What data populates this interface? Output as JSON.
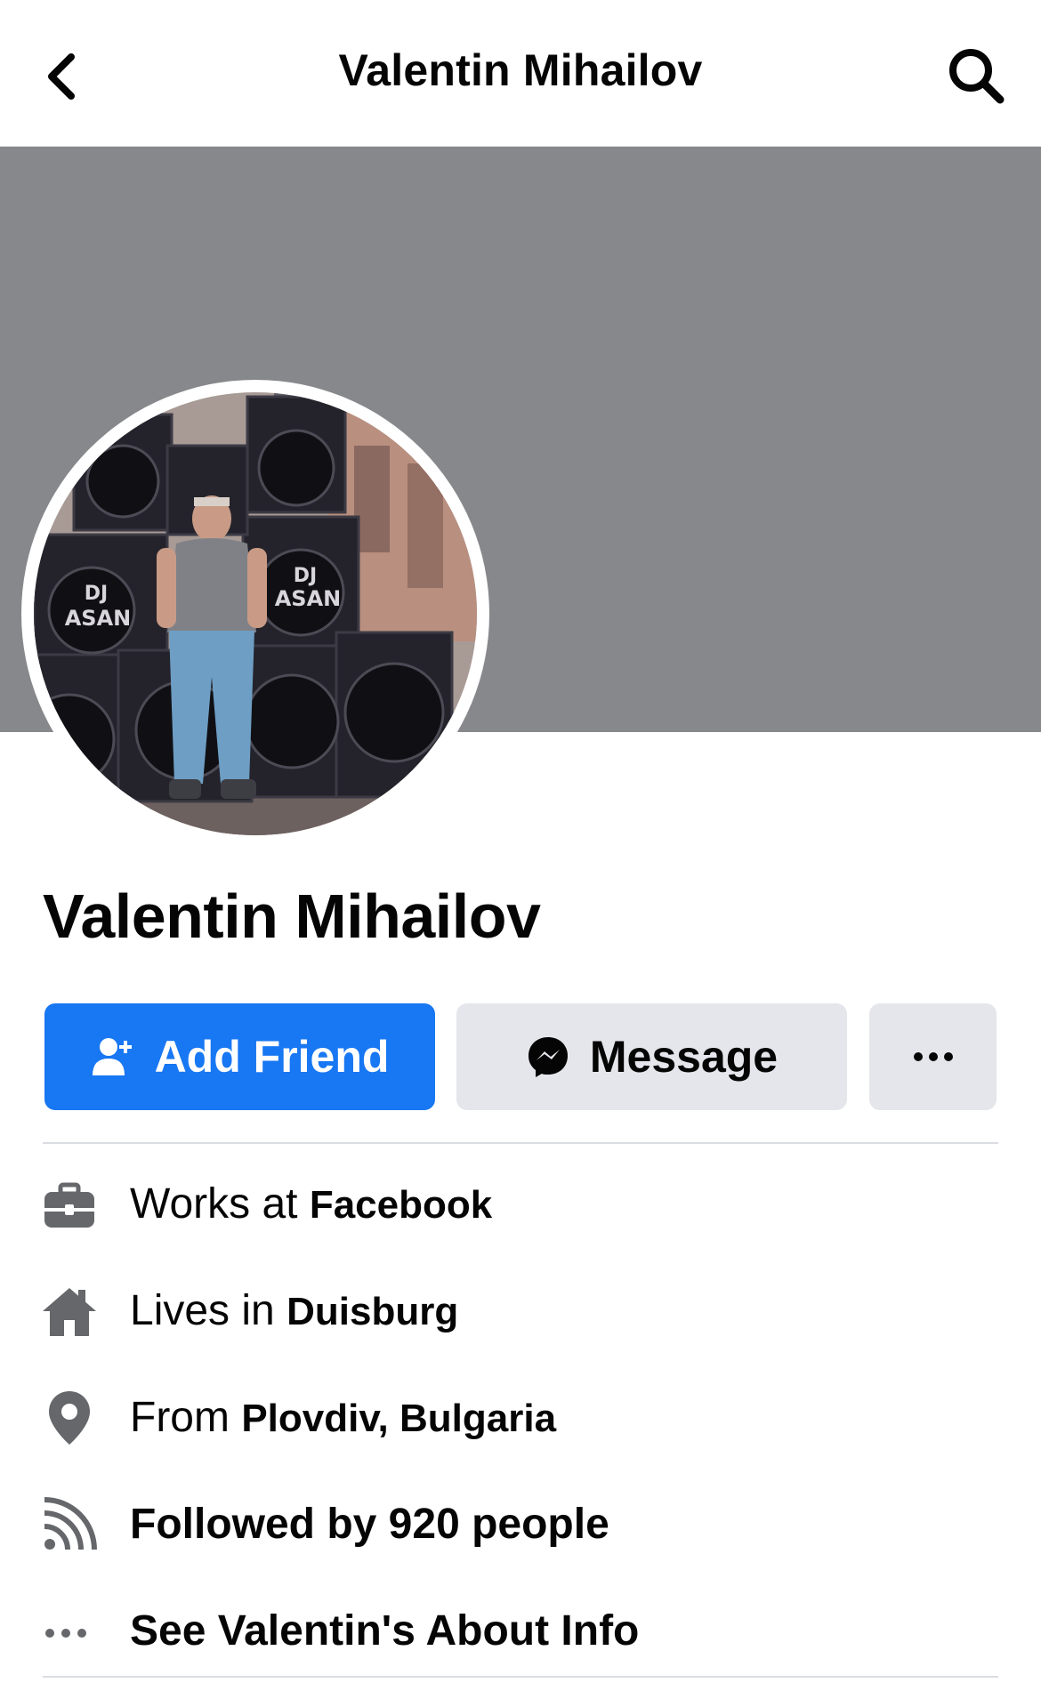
{
  "header": {
    "title": "Valentin Mihailov",
    "back_icon": "chevron-left-icon",
    "search_icon": "search-icon"
  },
  "cover": {
    "color": "#87888c"
  },
  "avatar": {
    "speaker_label_1": "DJ",
    "speaker_label_2": "ASAN",
    "speaker_label_3": "DJ",
    "speaker_label_4": "ASAN"
  },
  "profile": {
    "name": "Valentin Mihailov"
  },
  "actions": {
    "add_friend": "Add Friend",
    "message": "Message",
    "more": "···",
    "primary_color": "#1877f2",
    "secondary_color": "#e4e6eb"
  },
  "intro": [
    {
      "icon": "briefcase-icon",
      "prefix": "Works at ",
      "value": "Facebook"
    },
    {
      "icon": "home-icon",
      "prefix": "Lives in ",
      "value": "Duisburg"
    },
    {
      "icon": "location-pin-icon",
      "prefix": "From ",
      "value": "Plovdiv, Bulgaria"
    },
    {
      "icon": "rss-feed-icon",
      "text": "Followed by 920 people"
    },
    {
      "icon": "more-dots-icon",
      "text": "See Valentin's About Info"
    }
  ]
}
